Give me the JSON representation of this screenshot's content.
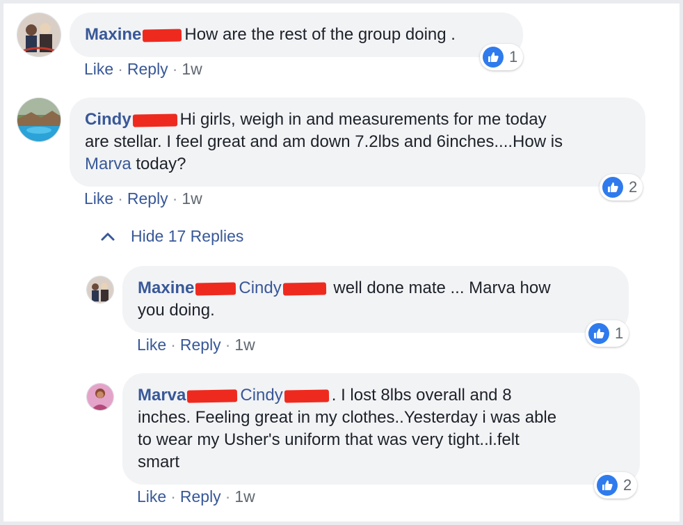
{
  "comments": [
    {
      "author": "Maxine",
      "text": "How are the rest of the group doing .",
      "like": "Like",
      "reply": "Reply",
      "time": "1w",
      "reactions": "1"
    },
    {
      "author": "Cindy",
      "text_line1": "Hi girls, weigh in and measurements for me today",
      "text_line2": "are stellar. I feel great and am down 7.2lbs and 6inches....How is",
      "mention": "Marva",
      "text_line3": "today?",
      "like": "Like",
      "reply": "Reply",
      "time": "1w",
      "reactions": "2"
    }
  ],
  "hide_replies": "Hide 17 Replies",
  "replies": [
    {
      "author": "Maxine",
      "mention": "Cindy",
      "text_line1": "well done mate ... Marva how",
      "text_line2": "you doing.",
      "like": "Like",
      "reply": "Reply",
      "time": "1w",
      "reactions": "1"
    },
    {
      "author": "Marva",
      "mention": "Cindy",
      "text_line1": ". I lost 8lbs overall and 8",
      "text_line2": "inches. Feeling great in my clothes..Yesterday i was able",
      "text_line3": "to wear my Usher's uniform that was very tight..i.felt",
      "text_line4": "smart",
      "like": "Like",
      "reply": "Reply",
      "time": "1w",
      "reactions": "2"
    }
  ],
  "colors": {
    "link": "#385898",
    "bubble": "#f2f3f5",
    "like_badge": "#2f7bed",
    "redaction": "#ee2a1f"
  }
}
